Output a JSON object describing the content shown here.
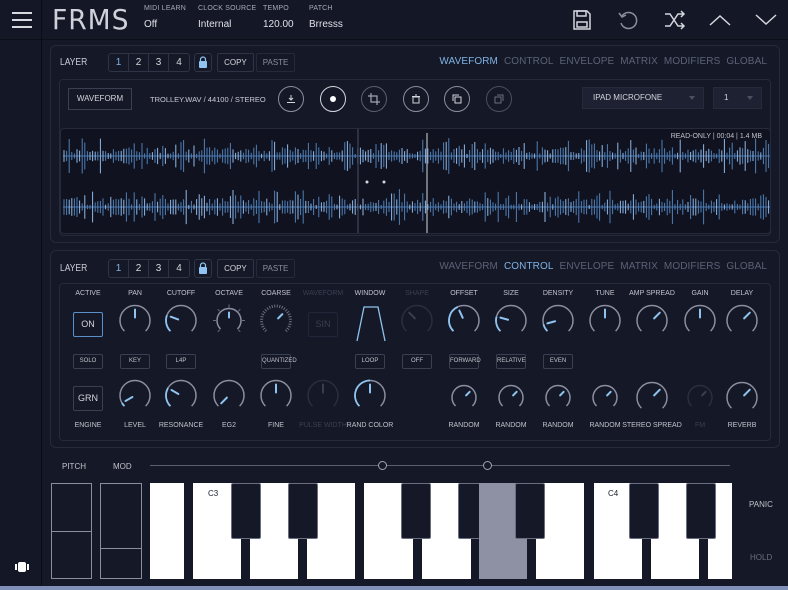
{
  "app": {
    "title": "FRMS"
  },
  "topbar": {
    "info": [
      {
        "label": "MIDI LEARN",
        "value": "Off"
      },
      {
        "label": "CLOCK SOURCE",
        "value": "Internal"
      },
      {
        "label": "TEMPO",
        "value": "120.00"
      },
      {
        "label": "PATCH",
        "value": "Brresss"
      }
    ],
    "icons": [
      "save-icon",
      "undo-icon",
      "shuffle-icon",
      "chevron-up-icon",
      "chevron-down-icon"
    ]
  },
  "layer_panel_1": {
    "label": "LAYER",
    "layers": [
      "1",
      "2",
      "3",
      "4"
    ],
    "selected_layer": "1",
    "copy_label": "COPY",
    "paste_label": "PASTE",
    "tabs": [
      {
        "label": "WAVEFORM",
        "active": true
      },
      {
        "label": "CONTROL",
        "active": false
      },
      {
        "label": "ENVELOPE",
        "active": false
      },
      {
        "label": "MATRIX",
        "active": false
      },
      {
        "label": "MODIFIERS",
        "active": false
      },
      {
        "label": "GLOBAL",
        "active": false
      }
    ],
    "waveform_button": "WAVEFORM",
    "file_info": "TROLLEY.WAV / 44100 / STEREO",
    "actions": [
      "download-icon",
      "record-icon",
      "crop-icon",
      "delete-icon",
      "copy-icon",
      "paste-icon"
    ],
    "input_source": "IPAD MICROFONE",
    "channel": "1",
    "waveform_status": "READ-ONLY  |  00:04  |  1.4 MB"
  },
  "layer_panel_2": {
    "label": "LAYER",
    "layers": [
      "1",
      "2",
      "3",
      "4"
    ],
    "selected_layer": "1",
    "copy_label": "COPY",
    "paste_label": "PASTE",
    "tabs": [
      {
        "label": "WAVEFORM",
        "active": false
      },
      {
        "label": "CONTROL",
        "active": true
      },
      {
        "label": "ENVELOPE",
        "active": false
      },
      {
        "label": "MATRIX",
        "active": false
      },
      {
        "label": "MODIFIERS",
        "active": false
      },
      {
        "label": "GLOBAL",
        "active": false
      }
    ],
    "top_labels": [
      "ACTIVE",
      "PAN",
      "CUTOFF",
      "OCTAVE",
      "COARSE",
      "WAVEFORM",
      "WINDOW",
      "SHAPE",
      "OFFSET",
      "SIZE",
      "DENSITY",
      "TUNE",
      "AMP SPREAD",
      "GAIN",
      "DELAY"
    ],
    "active_button": "ON",
    "waveform_button": "SIN",
    "mid_buttons": {
      "solo": "SOLO",
      "key": "KEY",
      "filter": "L4P",
      "coarse": "QUANTIZED",
      "window": "LOOP",
      "shape": "OFF",
      "offset": "FORWARD",
      "size": "RELATIVE",
      "density": "EVEN"
    },
    "engine_button": "GRN",
    "bottom_labels": [
      "ENGINE",
      "LEVEL",
      "RESONANCE",
      "EG2",
      "FINE",
      "PULSE WIDTH",
      "RAND COLOR",
      "RANDOM",
      "RANDOM",
      "RANDOM",
      "RANDOM",
      "STEREO SPREAD",
      "FM",
      "REVERB"
    ]
  },
  "keyboard": {
    "pitch_label": "PITCH",
    "mod_label": "MOD",
    "note_labels": [
      "C3",
      "C4"
    ],
    "panic_label": "PANIC",
    "hold_label": "HOLD"
  }
}
